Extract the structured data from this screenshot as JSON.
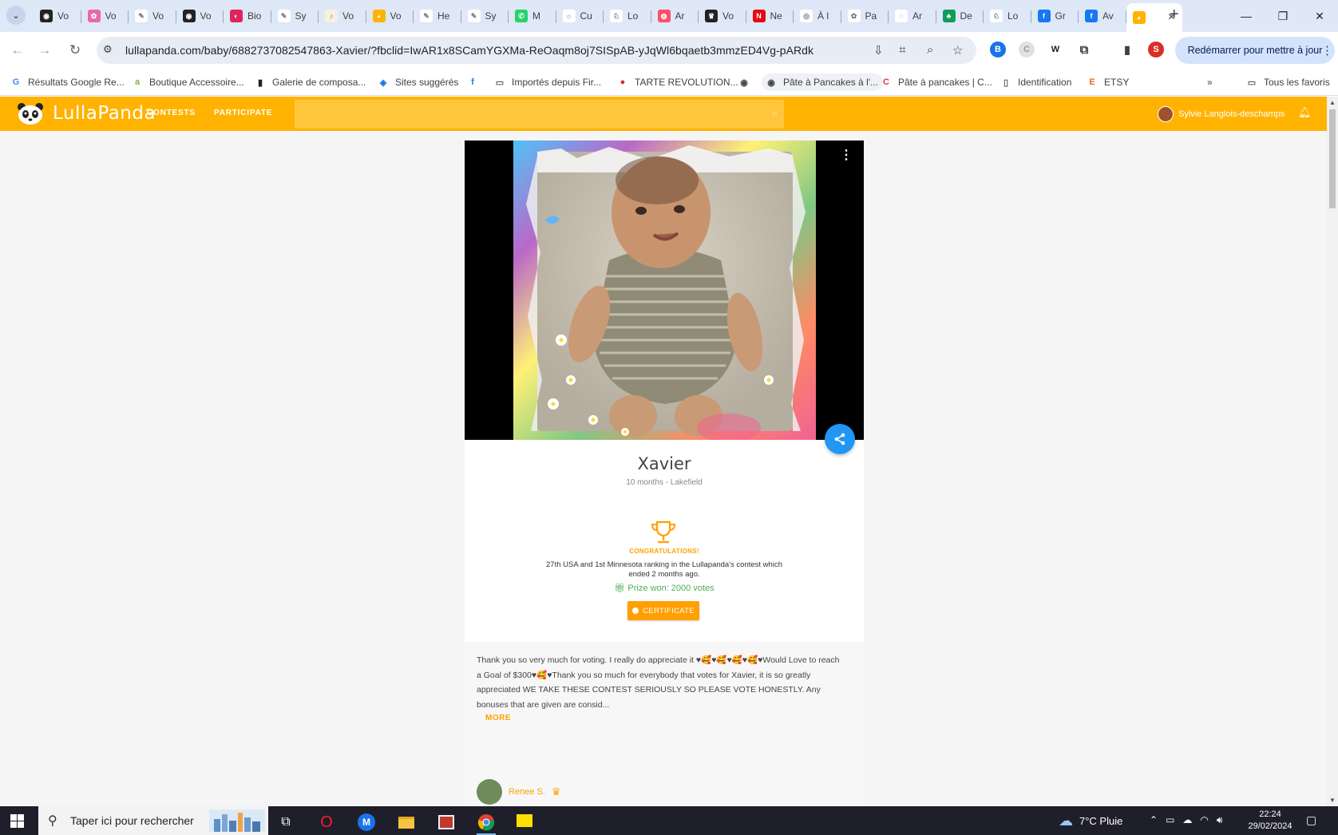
{
  "browser": {
    "tabs": [
      {
        "label": "Vo",
        "color": "#222222",
        "glyph": "◉"
      },
      {
        "label": "Vo",
        "color": "#e86aa6",
        "glyph": "✿"
      },
      {
        "label": "Vo",
        "color": "#ffffff",
        "glyph": "✎"
      },
      {
        "label": "Vo",
        "color": "#222222",
        "glyph": "◉"
      },
      {
        "label": "Bio",
        "color": "#e0245e",
        "glyph": "◐"
      },
      {
        "label": "Sy",
        "color": "#ffffff",
        "glyph": "✎"
      },
      {
        "label": "Vo",
        "color": "#f7f0e0",
        "glyph": "♪"
      },
      {
        "label": "Vo",
        "color": "#ffb300",
        "glyph": "◕"
      },
      {
        "label": "He",
        "color": "#ffffff",
        "glyph": "✎"
      },
      {
        "label": "Sy",
        "color": "#ffffff",
        "glyph": "✎"
      },
      {
        "label": "M",
        "color": "#25d366",
        "glyph": "✆"
      },
      {
        "label": "Cu",
        "color": "#ffffff",
        "glyph": "☼"
      },
      {
        "label": "Lo",
        "color": "#ffffff",
        "glyph": "♘"
      },
      {
        "label": "Ar",
        "color": "#ff4d6d",
        "glyph": "◍"
      },
      {
        "label": "Vo",
        "color": "#222222",
        "glyph": "♛"
      },
      {
        "label": "Ne",
        "color": "#e50914",
        "glyph": "N"
      },
      {
        "label": "À l",
        "color": "#ffffff",
        "glyph": "◎"
      },
      {
        "label": "Pa",
        "color": "#ffffff",
        "glyph": "✿"
      },
      {
        "label": "Ar",
        "color": "#ffffff",
        "glyph": "◌"
      },
      {
        "label": "De",
        "color": "#0f9d58",
        "glyph": "♣"
      },
      {
        "label": "Lo",
        "color": "#ffffff",
        "glyph": "♘"
      },
      {
        "label": "Gr",
        "color": "#1877f2",
        "glyph": "f"
      },
      {
        "label": "Av",
        "color": "#1877f2",
        "glyph": "f"
      }
    ],
    "active_tab_glyph": "◕",
    "url": "lullapanda.com/baby/6882737082547863-Xavier/?fbclid=IwAR1x8SCamYGXMa-ReOaqm8oj7SISpAB-yJqWl6bqaetb3mmzED4Vg-pARdk",
    "restart_label": "Redémarrer pour mettre à jour",
    "profile_initial": "S",
    "bookmarks": [
      {
        "label": "Résultats Google Re...",
        "icon": "G",
        "color": "#4285f4"
      },
      {
        "label": "Boutique Accessoire...",
        "icon": "a",
        "color": "#7cb342"
      },
      {
        "label": "Galerie de composa...",
        "icon": "▮",
        "color": "#222222"
      },
      {
        "label": "Sites suggérés",
        "icon": "◈",
        "color": "#1a73e8"
      },
      {
        "label": "",
        "icon": "f",
        "color": "#1877f2"
      },
      {
        "label": "Importés depuis Fir...",
        "icon": "▭",
        "color": "#5f6368"
      },
      {
        "label": "TARTE REVOLUTION...",
        "icon": "●",
        "color": "#d32f2f"
      },
      {
        "label": "",
        "icon": "◉",
        "color": "#444444"
      },
      {
        "label": "Pâte à Pancakes à l'...",
        "icon": "◉",
        "color": "#444444"
      },
      {
        "label": "Pâte à pancakes | C...",
        "icon": "C",
        "color": "#e53935"
      },
      {
        "label": "Identification",
        "icon": "▯",
        "color": "#5f6368"
      },
      {
        "label": "ETSY",
        "icon": "E",
        "color": "#f1641e"
      }
    ],
    "bookmarks_overflow": "»",
    "all_bookmarks_label": "Tous les favoris"
  },
  "site": {
    "logo_text": "LullaPanda",
    "nav": [
      "CONTESTS",
      "PARTICIPATE"
    ],
    "user_name": "Sylvie Langlois-deschamps",
    "accent_color": "#ffb300"
  },
  "profile": {
    "name": "Xavier",
    "meta": "10 months - Lakefield",
    "congrats": "CONGRATULATIONS!",
    "ranking": "27th USA and 1st Minnesota ranking in the Lullapanda's contest which ended 2 months ago.",
    "prize": "Prize won: 2000 votes",
    "certificate": "CERTIFICATE",
    "description": "Thank you so very much for voting. I really do appreciate it ♥🥰♥🥰♥🥰♥🥰♥Would Love to reach a Goal of $300♥🥰♥Thank you so much for everybody that votes for Xavier, it is so greatly appreciated WE TAKE THESE CONTEST SERIOUSLY SO PLEASE VOTE HONESTLY. Any bonuses that are given are consid...",
    "more": "MORE",
    "voter_name": "Renee S."
  },
  "taskbar": {
    "search_placeholder": "Taper ici pour rechercher",
    "weather": "7°C  Pluie",
    "time": "22:24",
    "date": "29/02/2024"
  }
}
